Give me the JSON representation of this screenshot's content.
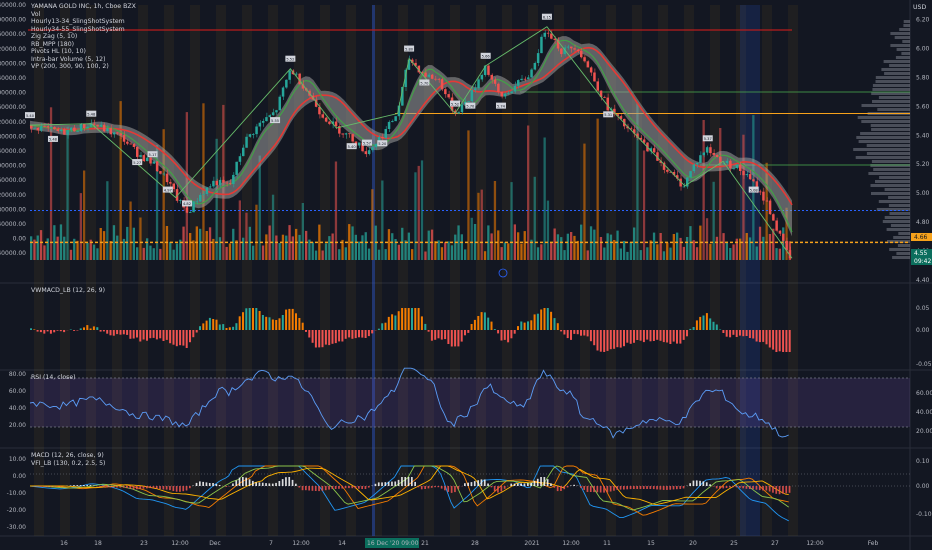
{
  "legend": {
    "title": "YAMANA GOLD INC, 1h, Cboe BZX",
    "items": [
      "Vol",
      "Hourly13-34_SlingShotSystem",
      "Hourly34-55_SlingShotSystem",
      "Zig Zag (5, 10)",
      "RB_MPP (180)",
      "Pivots HL (10, 10)",
      "Intra-bar Volume (5, 12)",
      "VP (200, 300, 90, 100, 2)"
    ]
  },
  "currency": "USD",
  "panes": {
    "vwmacd": "VWMACD_LB (12, 26, 9)",
    "rsi": "RSI (14, close)",
    "macd": "MACD (12, 26, close, 9)",
    "vfi": "VFI_LB (130, 0.2, 2.5, 5)"
  },
  "price_axis": [
    "6.20",
    "6.00",
    "5.80",
    "5.60",
    "5.40",
    "5.20",
    "5.00",
    "4.80",
    "4.60",
    "4.40"
  ],
  "volume_axis": [
    "640000.00",
    "600000.00",
    "560000.00",
    "520000.00",
    "480000.00",
    "440000.00",
    "400000.00",
    "360000.00",
    "320000.00",
    "280000.00",
    "240000.00",
    "200000.00",
    "160000.00",
    "120000.00",
    "80000.00",
    "40000.00",
    "0.00",
    "-40000.00"
  ],
  "price_tags": [
    {
      "text": "4.66",
      "bg": "#f7a21b",
      "fg": "#131722"
    },
    {
      "text": "4.55",
      "bg": "#0b6e5d",
      "fg": "#ffffff"
    },
    {
      "text": "09:42",
      "bg": "#0b6e5d",
      "fg": "#ffffff"
    }
  ],
  "vwmacd_axis": [
    "0.05",
    "0.00",
    "-0.05"
  ],
  "rsi_axis": [
    "60.00",
    "40.00",
    "20.00"
  ],
  "rsi_left_axis": [
    "80.00",
    "60.00",
    "40.00",
    "20.00"
  ],
  "macd_axis": [
    "0.10",
    "0.00",
    "-0.10"
  ],
  "macd_left_axis": [
    "10.00",
    "0.00",
    "-10.00",
    "-20.00",
    "-30.00"
  ],
  "time_axis": [
    "16",
    "18",
    "23",
    "12:00",
    "Dec",
    "7",
    "12:00",
    "14",
    "16 Dec '20",
    "09:00",
    "21",
    "28",
    "2021",
    "12:00",
    "11",
    "15",
    "20",
    "25",
    "27",
    "12:00",
    "Feb"
  ],
  "zigzag_labels": [
    "5.40",
    "5.48",
    "5.48",
    "5.27",
    "5.17",
    "4.97",
    "4.82",
    "5.55",
    "5.52",
    "5.40",
    "5.57",
    "5.20",
    "5.80",
    "5.70",
    "5.52",
    "5.70",
    "5.66",
    "5.74",
    "6.15",
    "5.31",
    "5.37",
    "5.08"
  ],
  "chart_data": {
    "type": "line",
    "title": "YAMANA GOLD INC, 1h, Cboe BZX",
    "ylabel": "USD",
    "ylim": [
      4.4,
      6.3
    ],
    "price_series": [
      {
        "t": 0,
        "p": 5.47
      },
      {
        "t": 4,
        "p": 5.44
      },
      {
        "t": 8,
        "p": 5.42
      },
      {
        "t": 12,
        "p": 5.45
      },
      {
        "t": 16,
        "p": 5.48
      },
      {
        "t": 20,
        "p": 5.43
      },
      {
        "t": 24,
        "p": 5.38
      },
      {
        "t": 28,
        "p": 5.27
      },
      {
        "t": 32,
        "p": 5.2
      },
      {
        "t": 36,
        "p": 5.08
      },
      {
        "t": 38,
        "p": 4.97
      },
      {
        "t": 41,
        "p": 4.86
      },
      {
        "t": 44,
        "p": 4.98
      },
      {
        "t": 48,
        "p": 5.08
      },
      {
        "t": 52,
        "p": 5.05
      },
      {
        "t": 56,
        "p": 5.36
      },
      {
        "t": 60,
        "p": 5.48
      },
      {
        "t": 64,
        "p": 5.56
      },
      {
        "t": 68,
        "p": 5.86
      },
      {
        "t": 72,
        "p": 5.72
      },
      {
        "t": 76,
        "p": 5.55
      },
      {
        "t": 80,
        "p": 5.45
      },
      {
        "t": 84,
        "p": 5.38
      },
      {
        "t": 88,
        "p": 5.28
      },
      {
        "t": 92,
        "p": 5.4
      },
      {
        "t": 96,
        "p": 5.55
      },
      {
        "t": 99,
        "p": 5.93
      },
      {
        "t": 103,
        "p": 5.82
      },
      {
        "t": 107,
        "p": 5.78
      },
      {
        "t": 111,
        "p": 5.55
      },
      {
        "t": 115,
        "p": 5.66
      },
      {
        "t": 119,
        "p": 5.88
      },
      {
        "t": 123,
        "p": 5.66
      },
      {
        "t": 127,
        "p": 5.74
      },
      {
        "t": 131,
        "p": 5.83
      },
      {
        "t": 135,
        "p": 6.15
      },
      {
        "t": 139,
        "p": 5.98
      },
      {
        "t": 143,
        "p": 6.02
      },
      {
        "t": 147,
        "p": 5.82
      },
      {
        "t": 151,
        "p": 5.6
      },
      {
        "t": 155,
        "p": 5.48
      },
      {
        "t": 159,
        "p": 5.38
      },
      {
        "t": 163,
        "p": 5.28
      },
      {
        "t": 167,
        "p": 5.15
      },
      {
        "t": 171,
        "p": 5.05
      },
      {
        "t": 174,
        "p": 5.2
      },
      {
        "t": 177,
        "p": 5.31
      },
      {
        "t": 181,
        "p": 5.22
      },
      {
        "t": 185,
        "p": 5.18
      },
      {
        "t": 189,
        "p": 5.08
      },
      {
        "t": 193,
        "p": 4.93
      },
      {
        "t": 196,
        "p": 4.72
      },
      {
        "t": 199,
        "p": 4.55
      }
    ],
    "last_price": 4.55,
    "reference_levels": [
      4.66,
      5.55,
      4.88
    ]
  }
}
